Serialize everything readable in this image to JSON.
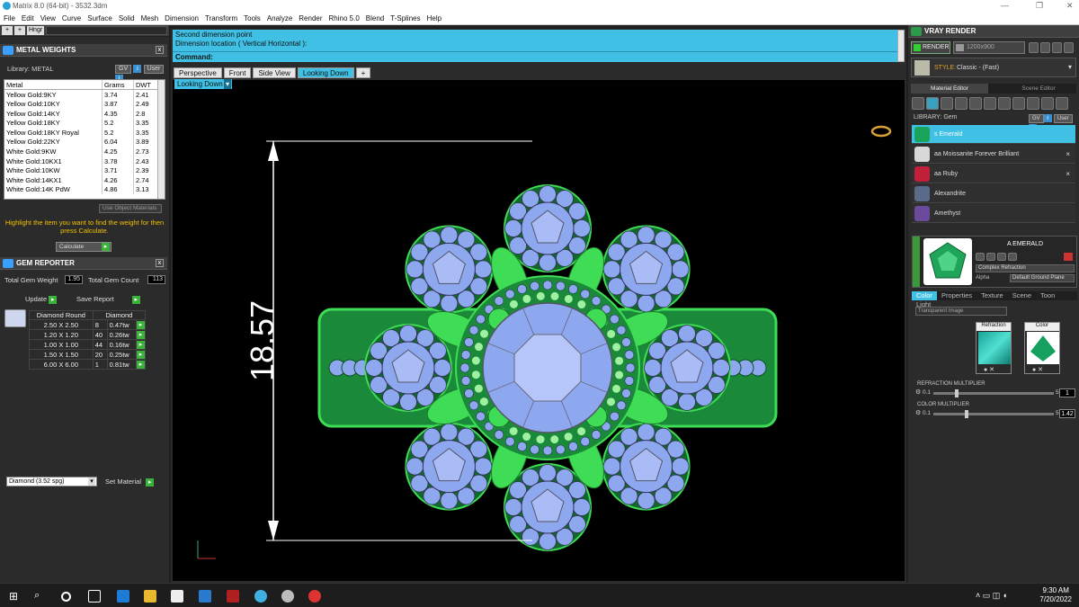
{
  "window": {
    "title": "Matrix 8.0 (64-bit) - 3532.3dm"
  },
  "menu": [
    "File",
    "Edit",
    "View",
    "Curve",
    "Surface",
    "Solid",
    "Mesh",
    "Dimension",
    "Transform",
    "Tools",
    "Analyze",
    "Render",
    "Rhino 5.0",
    "Blend",
    "T-Splines",
    "Help"
  ],
  "toolstrip": {
    "btn1": "+",
    "btn2": "+",
    "btn3": "Hngr"
  },
  "metal_weights": {
    "title": "METAL WEIGHTS",
    "library_label": "Library: METAL",
    "gv_label": "GV",
    "user_label": "User",
    "columns": [
      "Metal",
      "Grams",
      "DWT"
    ],
    "rows": [
      [
        "Yellow Gold:9KY",
        "3.74",
        "2.41"
      ],
      [
        "Yellow Gold:10KY",
        "3.87",
        "2.49"
      ],
      [
        "Yellow Gold:14KY",
        "4.35",
        "2.8"
      ],
      [
        "Yellow Gold:18KY",
        "5.2",
        "3.35"
      ],
      [
        "Yellow Gold:18KY Royal",
        "5.2",
        "3.35"
      ],
      [
        "Yellow Gold:22KY",
        "6.04",
        "3.89"
      ],
      [
        "White Gold:9KW",
        "4.25",
        "2.73"
      ],
      [
        "White Gold:10KX1",
        "3.78",
        "2.43"
      ],
      [
        "White Gold:10KW",
        "3.71",
        "2.39"
      ],
      [
        "White Gold:14KX1",
        "4.26",
        "2.74"
      ],
      [
        "White Gold:14K PdW",
        "4.86",
        "3.13"
      ]
    ],
    "use_object_materials": "Use Object Materials",
    "hint": "Highlight the item you want to find the weight for then press Calculate.",
    "calculate": "Calculate"
  },
  "gem_reporter": {
    "title": "GEM REPORTER",
    "total_weight_label": "Total Gem Weight",
    "total_weight": "1.95",
    "total_count_label": "Total Gem Count",
    "total_count": "113",
    "update": "Update",
    "save_report": "Save Report",
    "columns": [
      "Diamond Round",
      "Diamond"
    ],
    "rows": [
      [
        "2.50 X 2.50",
        "8",
        "0.47tw"
      ],
      [
        "1.20 X 1.20",
        "40",
        "0.26tw"
      ],
      [
        "1.00 X 1.00",
        "44",
        "0.16tw"
      ],
      [
        "1.50 X 1.50",
        "20",
        "0.25tw"
      ],
      [
        "6.00 X 6.00",
        "1",
        "0.81tw"
      ]
    ],
    "material_select": "Diamond    (3.52 spg)",
    "set_material": "Set Material"
  },
  "command": {
    "line1": "Second dimension point",
    "line2": "Dimension location ( Vertical  Horizontal ):",
    "prompt": "Command:"
  },
  "viewport_tabs": [
    "Perspective",
    "Front",
    "Side View",
    "Looking Down"
  ],
  "active_view": "Looking Down",
  "dimension_value": "18.57",
  "vray": {
    "title": "VRAY RENDER",
    "render": "RENDER",
    "resolution": "1200x900",
    "style_label": "STYLE:",
    "style_value": "Classic - (Fast)",
    "tab_material": "Material Editor",
    "tab_scene": "Scene Editor",
    "library_label": "LIBRARY: Gem",
    "materials": [
      {
        "name": "s Emerald",
        "color": "#1aa35a"
      },
      {
        "name": "aa Moissanite Forever Brilliant",
        "color": "#d8d8d8"
      },
      {
        "name": "aa Ruby",
        "color": "#c0203a"
      },
      {
        "name": "Alexandrite",
        "color": "#5a6a8a"
      },
      {
        "name": "Amethyst",
        "color": "#6a4a9a"
      }
    ],
    "selected_material": "A EMERALD",
    "complex_refraction": "Complex Refraction",
    "alpha_label": "Alpha",
    "ground_plane": "Default Ground Plane",
    "editor_tabs": [
      "Color",
      "Properties",
      "Texture",
      "Scene",
      "Toon",
      "Light"
    ],
    "transparent_image": "Transparent Image",
    "refraction_label": "Refraction",
    "color_label": "Color",
    "refraction_mult_label": "REFRACTION MULTIPLIER",
    "refraction_min": "0.1",
    "refraction_max": "5",
    "refraction_value": "1",
    "color_mult_label": "COLOR MULTIPLIER",
    "color_min": "0.1",
    "color_max": "5",
    "color_value": "1.42"
  },
  "taskbar": {
    "time": "9:30 AM",
    "date": "7/20/2022",
    "notif": "3"
  },
  "colors": {
    "accent": "#3fc0e4",
    "gem_blue": "#8ea8f0",
    "metal_green": "#3fdc55"
  }
}
